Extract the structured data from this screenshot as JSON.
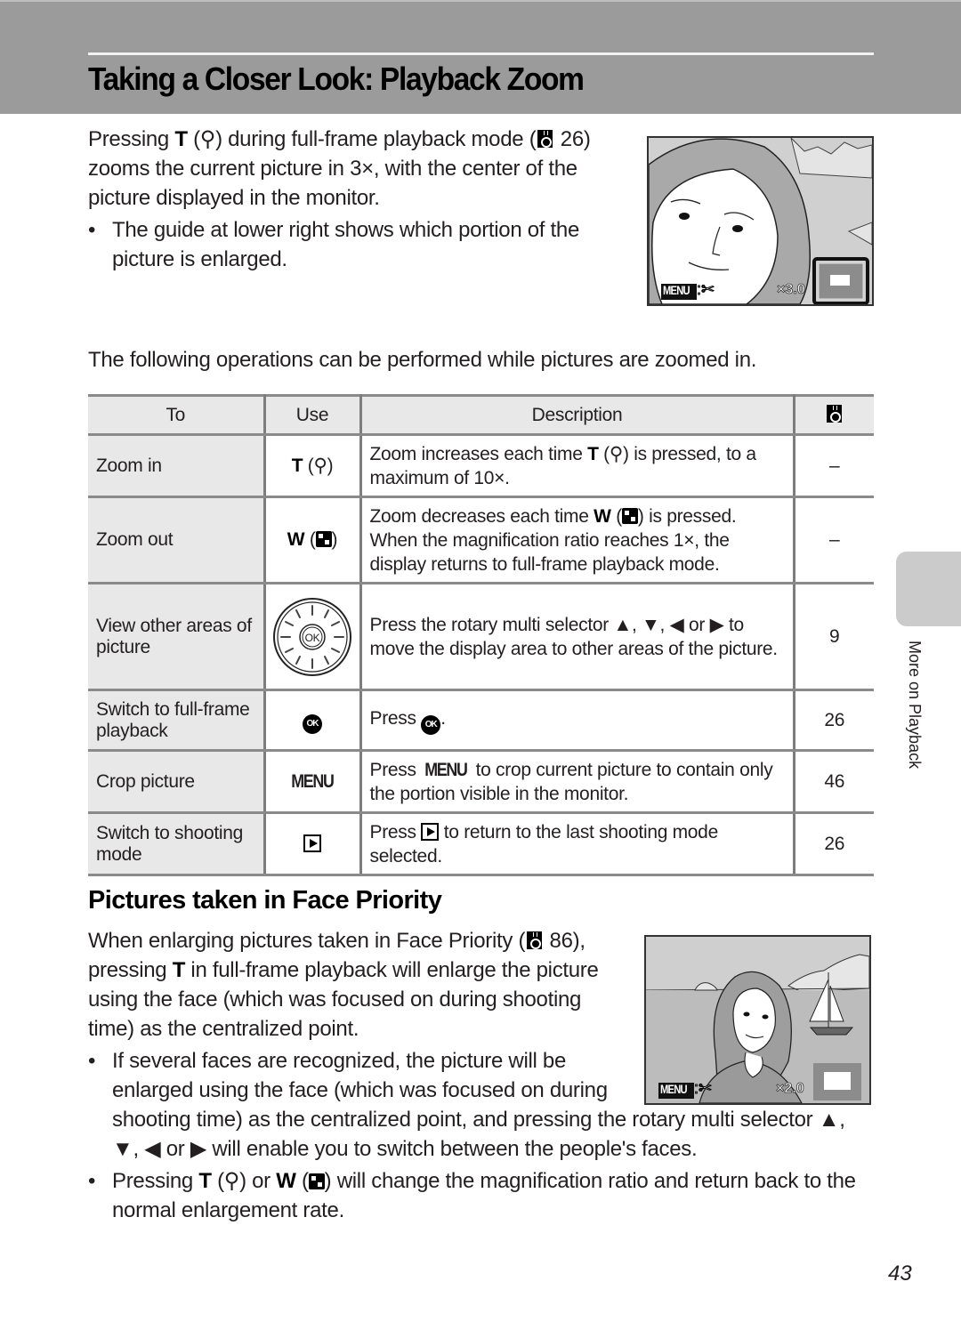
{
  "header": {
    "title": "Taking a Closer Look: Playback Zoom"
  },
  "intro": {
    "p1_before_key": "Pressing ",
    "key_t": "T",
    "p1_after_key": " during full-frame playback mode (",
    "p1_ref_page": "26",
    "p1_rest": ") zooms the current picture in 3×, with the center of the picture displayed in the monitor.",
    "bullet": "The guide at lower right shows which portion of the picture is enlarged."
  },
  "screen1": {
    "menu_label": "MENU",
    "zoom_readout": "×3.0",
    "icon": "scissors-icon"
  },
  "table_intro": "The following operations can be performed while pictures are zoomed in.",
  "table": {
    "headers": {
      "to": "To",
      "use": "Use",
      "description": "Description",
      "ref": "reference-icon"
    },
    "rows": [
      {
        "to": "Zoom in",
        "use_key": "T",
        "use_icon": "magnifier-icon",
        "desc_a": "Zoom increases each time ",
        "desc_key": "T",
        "desc_b": " is pressed, to a maximum of 10×.",
        "ref": "–"
      },
      {
        "to": "Zoom out",
        "use_key": "W",
        "use_icon": "thumbnail-icon",
        "desc_a": "Zoom decreases each time ",
        "desc_key": "W",
        "desc_b": " is pressed. When the magnification ratio reaches 1×, the display returns to full-frame playback mode.",
        "ref": "–"
      },
      {
        "to": "View other areas of picture",
        "use_icon": "rotary-multi-selector-icon",
        "desc": "Press the rotary multi selector ▲, ▼, ◀ or ▶ to move the display area to other areas of the picture.",
        "ref": "9"
      },
      {
        "to": "Switch to full-frame playback",
        "use_icon": "ok-button-icon",
        "use_label": "OK",
        "desc_a": "Press ",
        "desc_b": ".",
        "ref": "26"
      },
      {
        "to": "Crop picture",
        "use_label": "MENU",
        "desc_a": "Press ",
        "desc_key": "MENU",
        "desc_b": " to crop current picture to contain only the portion visible in the monitor.",
        "ref": "46"
      },
      {
        "to": "Switch to shooting mode",
        "use_icon": "playback-button-icon",
        "desc_a": "Press ",
        "desc_b": " to return to the last shooting mode selected.",
        "ref": "26"
      }
    ]
  },
  "face_section": {
    "title": "Pictures taken in Face Priority",
    "p1_a": "When enlarging pictures taken in Face Priority (",
    "p1_ref_page": "86",
    "p1_b": "), pressing ",
    "p1_key": "T",
    "p1_c": " in full-frame playback will enlarge the picture using the face (which was focused on during shooting time) as the centralized point.",
    "bullet1": "If several faces are recognized, the picture will be enlarged using the face (which was focused on during shooting time) as the centralized point, and pressing the rotary multi selector ▲, ▼, ◀ or ▶  will enable you to switch between the people's faces.",
    "bullet2_a": "Pressing ",
    "bullet2_key1": "T",
    "bullet2_b": " or ",
    "bullet2_key2": "W",
    "bullet2_c": " will change the magnification ratio and return back to the normal enlargement rate."
  },
  "screen2": {
    "menu_label": "MENU",
    "zoom_readout": "×2.0",
    "icon": "scissors-icon"
  },
  "side_tab": {
    "label": "More on Playback"
  },
  "page_number": "43",
  "colors": {
    "header_band": "#9b9b9b",
    "table_shade": "#e8e8e8",
    "side_tab": "#cbcbcb"
  }
}
